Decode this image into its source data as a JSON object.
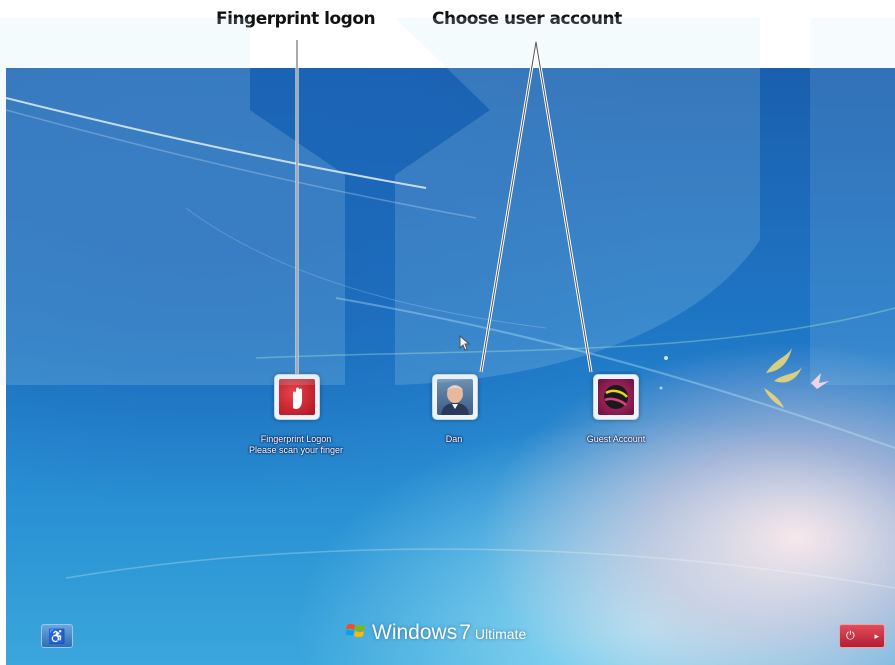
{
  "annotations": {
    "fingerprint": "Fingerprint logon",
    "choose_account": "Choose user account"
  },
  "users": [
    {
      "line1": "Fingerprint Logon",
      "line2": "Please scan your finger",
      "icon": "fingerprint-hand-icon"
    },
    {
      "line1": "Dan",
      "line2": "",
      "icon": "user-photo-icon"
    },
    {
      "line1": "Guest Account",
      "line2": "",
      "icon": "user-ball-icon"
    }
  ],
  "brand": {
    "name": "Windows",
    "version": "7",
    "edition": "Ultimate"
  },
  "buttons": {
    "ease_icon": "ease-of-access-icon",
    "power_icon": "shutdown-icon"
  },
  "colors": {
    "background_blue": "#1f77c6",
    "power_red": "#c42a3d",
    "annotation_text": "#111111"
  }
}
